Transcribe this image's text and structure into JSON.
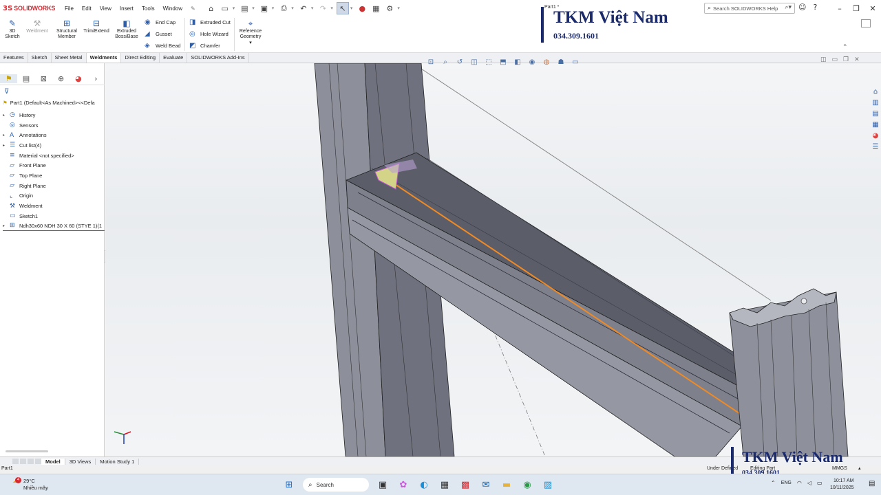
{
  "app": {
    "brand_ds": "3S",
    "brand_name": "SOLIDWORKS",
    "doc_title": "Part1 *",
    "menu": [
      "File",
      "Edit",
      "View",
      "Insert",
      "Tools",
      "Window"
    ],
    "search_placeholder": "Search SOLIDWORKS Help"
  },
  "ribbon": {
    "sketch3d": "3D Sketch",
    "weldment": "Weldment",
    "structural_member": "Structural Member",
    "trim_extend": "Trim/Extend",
    "extruded_boss": "Extruded Boss/Base",
    "end_cap": "End Cap",
    "gusset": "Gusset",
    "weld_bead": "Weld Bead",
    "extruded_cut": "Extruded Cut",
    "hole_wizard": "Hole Wizard",
    "chamfer": "Chamfer",
    "reference_geometry": "Reference Geometry"
  },
  "tabs": [
    "Features",
    "Sketch",
    "Sheet Metal",
    "Weldments",
    "Direct Editing",
    "Evaluate",
    "SOLIDWORKS Add-Ins"
  ],
  "active_tab": "Weldments",
  "feature_tree": {
    "root": "Part1  (Default<As Machined><<Defa",
    "items": [
      {
        "label": "History",
        "icon": "history-icon",
        "expand": true
      },
      {
        "label": "Sensors",
        "icon": "sensors-icon",
        "expand": false
      },
      {
        "label": "Annotations",
        "icon": "annotations-icon",
        "expand": true
      },
      {
        "label": "Cut list(4)",
        "icon": "cut-list-icon",
        "expand": true
      },
      {
        "label": "Material <not specified>",
        "icon": "material-icon",
        "expand": false
      },
      {
        "label": "Front Plane",
        "icon": "plane-icon",
        "expand": false
      },
      {
        "label": "Top Plane",
        "icon": "plane-icon",
        "expand": false
      },
      {
        "label": "Right Plane",
        "icon": "plane-icon",
        "expand": false
      },
      {
        "label": "Origin",
        "icon": "origin-icon",
        "expand": false
      },
      {
        "label": "Weldment",
        "icon": "weldment-icon",
        "expand": false
      },
      {
        "label": "Sketch1",
        "icon": "sketch-icon",
        "expand": false
      },
      {
        "label": "Ndh30x60 NDH 30 X 60 (STYE 1)(1",
        "icon": "structural-member-icon",
        "expand": true
      }
    ]
  },
  "watermark": {
    "name": "TKM Việt Nam",
    "phone": "034.309.1601"
  },
  "bottom_tabs": [
    "Model",
    "3D Views",
    "Motion Study 1"
  ],
  "active_bottom_tab": "Model",
  "status": {
    "left": "Part1",
    "state": "Under Defined",
    "mode": "Editing Part",
    "units": "MMGS"
  },
  "taskbar": {
    "temp": "29°C",
    "weather": "Nhiều mây",
    "weather_badge": "4",
    "search": "Search",
    "lang": "ENG",
    "time": "10:17 AM",
    "date": "10/11/2025"
  },
  "colors": {
    "brand": "#d7282f",
    "accent": "#2e5ea8",
    "profile": "#7d7f8a",
    "highlight": "#f08a24",
    "watermark": "#1b2a6b"
  }
}
